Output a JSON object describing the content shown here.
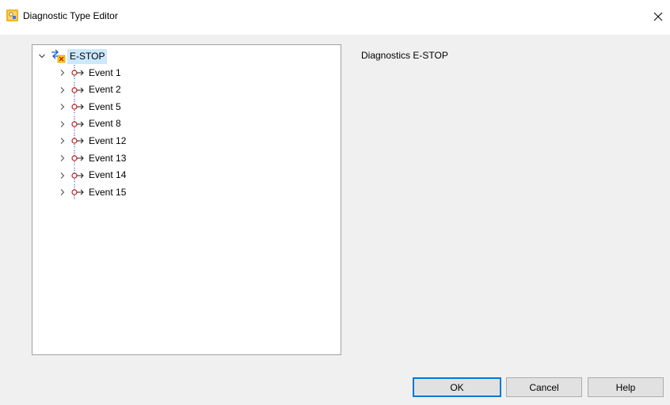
{
  "window": {
    "title": "Diagnostic Type Editor",
    "close_glyph": "×",
    "icon": "app-icon"
  },
  "tree": {
    "root": {
      "label": "E-STOP",
      "expanded": true,
      "selected": true,
      "icon": "diagnostic-type-icon"
    },
    "events": [
      {
        "label": "Event 1"
      },
      {
        "label": "Event 2"
      },
      {
        "label": "Event 5"
      },
      {
        "label": "Event 8"
      },
      {
        "label": "Event 12"
      },
      {
        "label": "Event 13"
      },
      {
        "label": "Event 14"
      },
      {
        "label": "Event 15"
      }
    ]
  },
  "detail": {
    "description": "Diagnostics E-STOP"
  },
  "buttons": {
    "ok": "OK",
    "cancel": "Cancel",
    "help": "Help"
  },
  "colors": {
    "selection": "#cce8ff",
    "default_button_border": "#0078d7"
  }
}
